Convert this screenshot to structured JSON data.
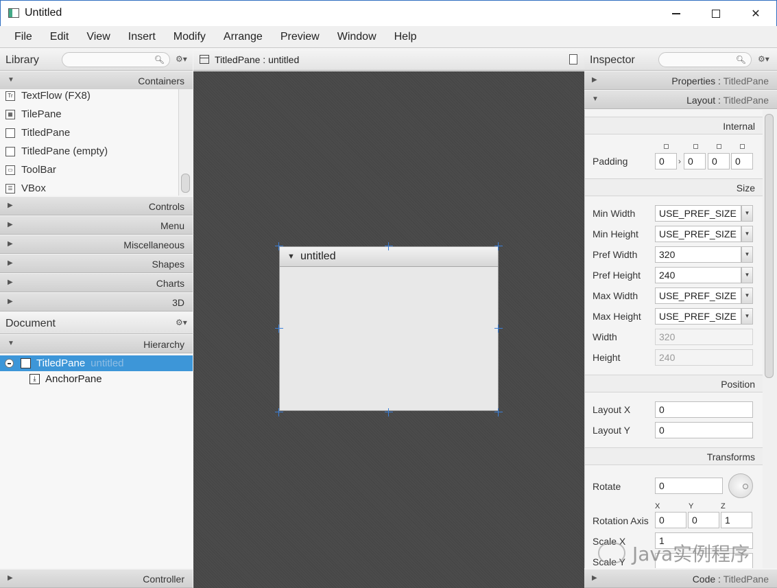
{
  "window": {
    "title": "Untitled",
    "minimize": "—",
    "close": "✕"
  },
  "menu": [
    "File",
    "Edit",
    "View",
    "Insert",
    "Modify",
    "Arrange",
    "Preview",
    "Window",
    "Help"
  ],
  "library": {
    "title": "Library",
    "containers_label": "Containers",
    "items": [
      {
        "label": "TextFlow  (FX8)",
        "icon": "Tr"
      },
      {
        "label": "TilePane",
        "icon": "▦"
      },
      {
        "label": "TitledPane",
        "icon": ""
      },
      {
        "label": "TitledPane  (empty)",
        "icon": ""
      },
      {
        "label": "ToolBar",
        "icon": "▭"
      },
      {
        "label": "VBox",
        "icon": "☰"
      }
    ],
    "sections": [
      "Controls",
      "Menu",
      "Miscellaneous",
      "Shapes",
      "Charts",
      "3D"
    ]
  },
  "document": {
    "title": "Document",
    "hierarchy_label": "Hierarchy",
    "tree": [
      {
        "label": "TitledPane",
        "sub": "untitled"
      },
      {
        "label": "AnchorPane"
      }
    ],
    "controller_label": "Controller"
  },
  "editor": {
    "tab_title": "TitledPane : untitled",
    "pane_title": "untitled"
  },
  "inspector": {
    "title": "Inspector",
    "properties": {
      "label": "Properties",
      "sep": " : ",
      "target": "TitledPane"
    },
    "layout": {
      "label": "Layout",
      "sep": " : ",
      "target": "TitledPane"
    },
    "code": {
      "label": "Code",
      "sep": " : ",
      "target": "TitledPane"
    },
    "internal": "Internal",
    "padding_label": "Padding",
    "padding": [
      "0",
      "0",
      "0",
      "0"
    ],
    "padding_sep": "›",
    "size": "Size",
    "size_rows": [
      {
        "label": "Min Width",
        "value": "USE_PREF_SIZE"
      },
      {
        "label": "Min Height",
        "value": "USE_PREF_SIZE"
      },
      {
        "label": "Pref Width",
        "value": "320"
      },
      {
        "label": "Pref Height",
        "value": "240"
      },
      {
        "label": "Max Width",
        "value": "USE_PREF_SIZE"
      },
      {
        "label": "Max Height",
        "value": "USE_PREF_SIZE"
      }
    ],
    "width_label": "Width",
    "width_value": "320",
    "height_label": "Height",
    "height_value": "240",
    "position": "Position",
    "layout_x_label": "Layout X",
    "layout_x": "0",
    "layout_y_label": "Layout Y",
    "layout_y": "0",
    "transforms": "Transforms",
    "rotate_label": "Rotate",
    "rotate": "0",
    "axis_labels": [
      "X",
      "Y",
      "Z"
    ],
    "rotation_axis_label": "Rotation Axis",
    "rotation_axis": [
      "0",
      "0",
      "1"
    ],
    "scale_x_label": "Scale X",
    "scale_x": "1",
    "scale_y_label": "Scale Y"
  },
  "watermark": "Java实例程序"
}
